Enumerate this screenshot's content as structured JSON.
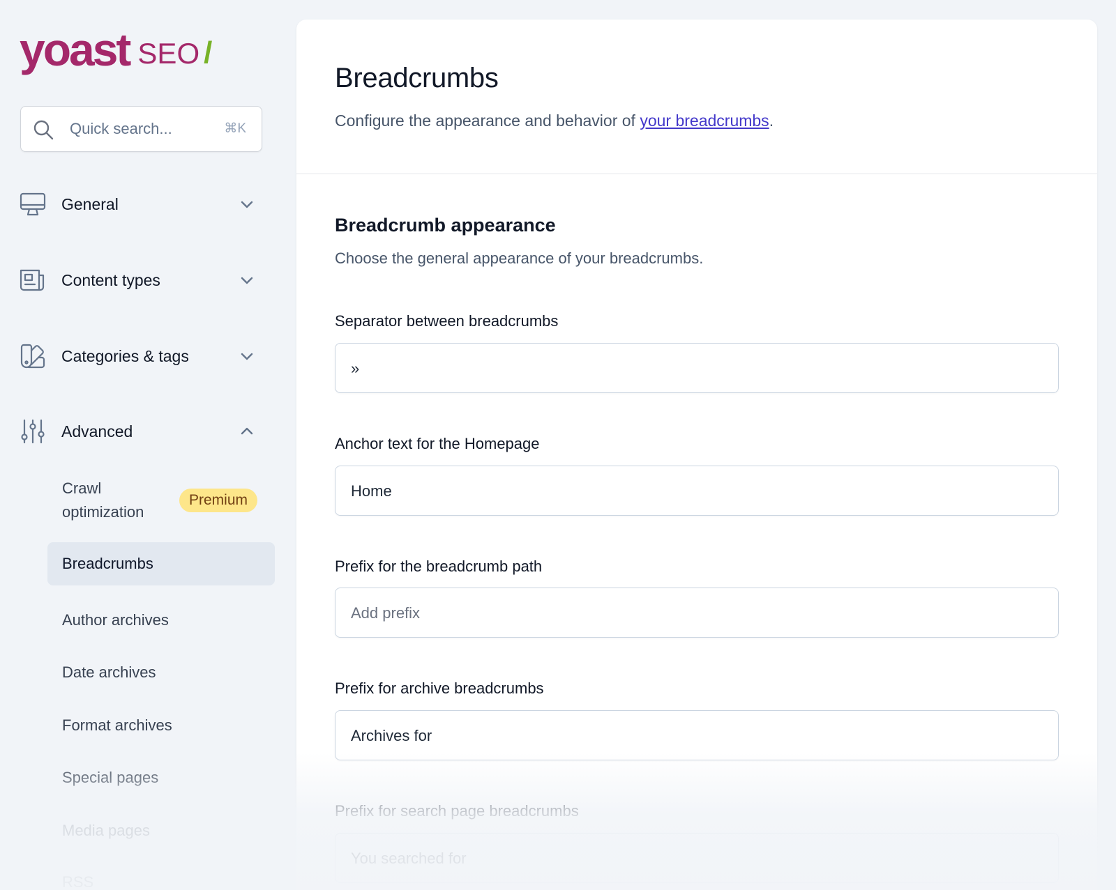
{
  "logo": {
    "brand": "yoast",
    "product": "SEO",
    "slash": "/"
  },
  "search": {
    "placeholder": "Quick search...",
    "shortcut": "⌘K"
  },
  "sidebar": {
    "groups": [
      {
        "label": "General",
        "icon": "monitor-icon",
        "expanded": false
      },
      {
        "label": "Content types",
        "icon": "newspaper-icon",
        "expanded": false
      },
      {
        "label": "Categories & tags",
        "icon": "color-swatch-icon",
        "expanded": false
      },
      {
        "label": "Advanced",
        "icon": "adjustments-icon",
        "expanded": true
      }
    ],
    "advanced_items": [
      {
        "label": "Crawl optimization",
        "badge": "Premium"
      },
      {
        "label": "Breadcrumbs",
        "active": true
      },
      {
        "label": "Author archives"
      },
      {
        "label": "Date archives"
      },
      {
        "label": "Format archives"
      },
      {
        "label": "Special pages"
      },
      {
        "label": "Media pages"
      },
      {
        "label": "RSS"
      }
    ]
  },
  "page": {
    "title": "Breadcrumbs",
    "description_prefix": "Configure the appearance and behavior of ",
    "description_link": "your breadcrumbs",
    "description_suffix": "."
  },
  "section": {
    "title": "Breadcrumb appearance",
    "description": "Choose the general appearance of your breadcrumbs."
  },
  "fields": [
    {
      "label": "Separator between breadcrumbs",
      "value": "»",
      "placeholder": ""
    },
    {
      "label": "Anchor text for the Homepage",
      "value": "Home",
      "placeholder": ""
    },
    {
      "label": "Prefix for the breadcrumb path",
      "value": "",
      "placeholder": "Add prefix"
    },
    {
      "label": "Prefix for archive breadcrumbs",
      "value": "Archives for",
      "placeholder": ""
    },
    {
      "label": "Prefix for search page breadcrumbs",
      "value": "You searched for",
      "placeholder": ""
    }
  ],
  "colors": {
    "brand": "#a4286a",
    "brand_accent": "#77b227",
    "link": "#4338ca",
    "premium_badge_bg": "#fde68a",
    "premium_badge_text": "#713f12",
    "active_item_bg": "#e2e8f0"
  }
}
